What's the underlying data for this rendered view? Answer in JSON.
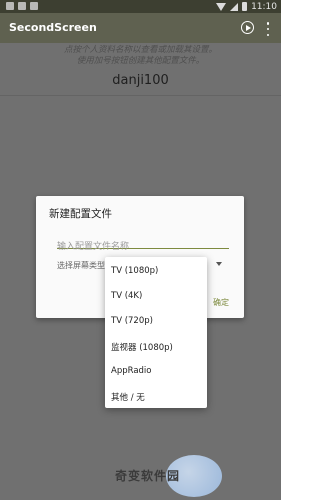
{
  "status_bar": {
    "time": "11:10",
    "left_icons": [
      "notification-icon",
      "notification-icon",
      "notification-icon"
    ],
    "right_icons": [
      "wifi-icon",
      "signal-icon",
      "battery-icon"
    ]
  },
  "app_bar": {
    "title": "SecondScreen",
    "actions": [
      "play-icon",
      "more-icon"
    ],
    "color": "#5f6150"
  },
  "main": {
    "hint_line1": "点按个人资料名称以查看或加载其设置。",
    "hint_line2": "使用加号按钮创建其他配置文件。",
    "device_name": "danji100"
  },
  "dialog": {
    "title": "新建配置文件",
    "name_input": {
      "value": "",
      "placeholder": "输入配置文件名称"
    },
    "screen_type_label": "选择屏幕类型:",
    "confirm": "确定",
    "accent_color": "#7d8a3e"
  },
  "dropdown": {
    "options": [
      "TV (1080p)",
      "TV (4K)",
      "TV (720p)",
      "监视器 (1080p)",
      "AppRadio",
      "其他 / 无"
    ]
  },
  "watermark": {
    "text": "奇变软件园"
  }
}
